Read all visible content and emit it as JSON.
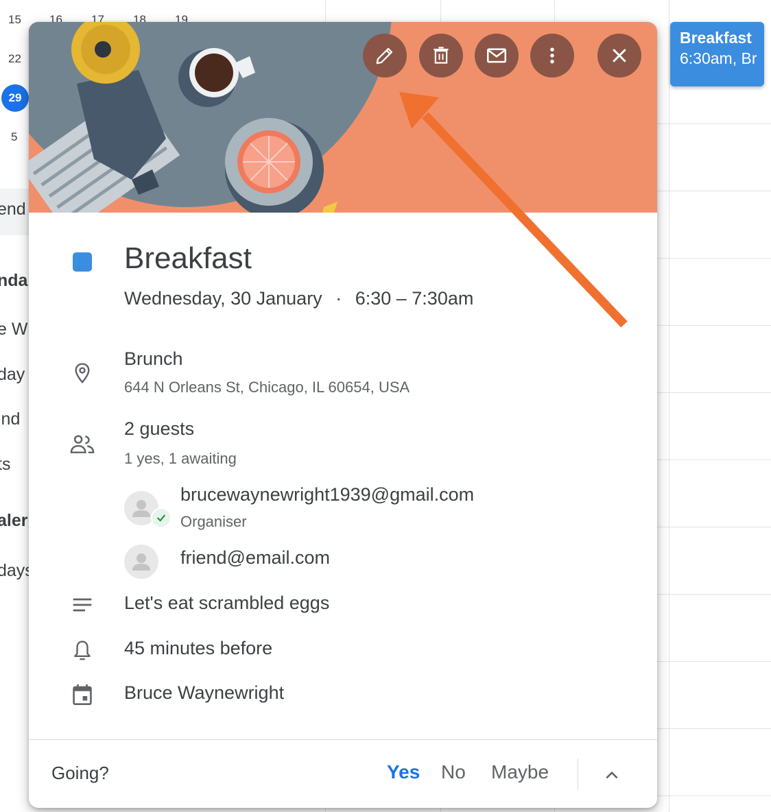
{
  "mini_calendar": {
    "row1": [
      "15",
      "16",
      "17",
      "18",
      "19"
    ],
    "row2": [
      "22"
    ],
    "today": "29",
    "row4": [
      "5"
    ]
  },
  "left_sidebar_fragments": [
    "end",
    "nda",
    "e W",
    "day",
    "ind",
    "ts",
    "aler",
    "days"
  ],
  "calendar_event_chip": {
    "title": "Breakfast",
    "subtitle": "6:30am, Br",
    "color": "#3b8de0"
  },
  "event_popup": {
    "header_color": "#f0906b",
    "toolbar": [
      {
        "name": "edit-button",
        "icon": "pencil-icon"
      },
      {
        "name": "delete-button",
        "icon": "trash-icon"
      },
      {
        "name": "email-guests-button",
        "icon": "mail-icon"
      },
      {
        "name": "more-options-button",
        "icon": "more-vert-icon"
      },
      {
        "name": "close-button",
        "icon": "close-icon"
      }
    ],
    "event_color": "#3b8de0",
    "title": "Breakfast",
    "date": "Wednesday, 30 January",
    "separator": "·",
    "time": "6:30 – 7:30am",
    "location": {
      "name": "Brunch",
      "address": "644 N Orleans St, Chicago, IL 60654, USA"
    },
    "guests": {
      "summary": "2 guests",
      "status": "1 yes, 1 awaiting",
      "list": [
        {
          "email": "brucewaynewright1939@gmail.com",
          "role": "Organiser"
        },
        {
          "email": "friend@email.com",
          "role": ""
        }
      ]
    },
    "description": "Let's eat scrambled eggs",
    "reminder": "45 minutes before",
    "calendar_owner": "Bruce Waynewright",
    "footer": {
      "prompt": "Going?",
      "yes": "Yes",
      "no": "No",
      "maybe": "Maybe"
    }
  },
  "annotation_color": "#f07030"
}
